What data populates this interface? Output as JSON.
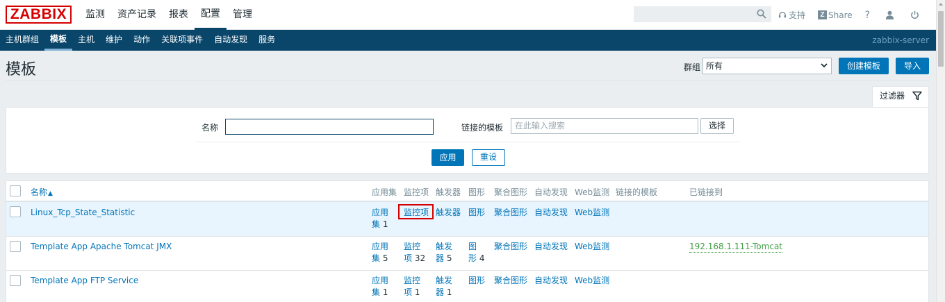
{
  "logo": "ZABBIX",
  "main_menu": [
    "监测",
    "资产记录",
    "报表",
    "配置",
    "管理"
  ],
  "main_menu_active": "配置",
  "search": {
    "placeholder": "",
    "value": ""
  },
  "tools": {
    "support": "支持",
    "share": "Share",
    "help": "?"
  },
  "sub_menu": [
    "主机群组",
    "模板",
    "主机",
    "维护",
    "动作",
    "关联项事件",
    "自动发现",
    "服务"
  ],
  "sub_menu_active": "模板",
  "server_name": "zabbix-server",
  "page_title": "模板",
  "header": {
    "group_label": "群组",
    "group_value": "所有",
    "create_button": "创建模板",
    "import_button": "导入"
  },
  "filter": {
    "tab_label": "过滤器",
    "name_label": "名称",
    "name_value": "",
    "linked_label": "链接的模板",
    "linked_placeholder": "在此输入搜索",
    "select_button": "选择",
    "apply_button": "应用",
    "reset_button": "重设"
  },
  "table": {
    "columns": {
      "name": "名称",
      "sort_indicator": "▲",
      "applications": "应用集",
      "items": "监控项",
      "triggers": "触发器",
      "graphs": "图形",
      "screens": "聚合图形",
      "discovery": "自动发现",
      "web": "Web监测",
      "linked_templates": "链接的模板",
      "linked_to": "已链接到"
    },
    "rows": [
      {
        "name": "Linux_Tcp_State_Statistic",
        "applications": {
          "line1": "应用",
          "line2": "集",
          "count": "1"
        },
        "items": "监控项",
        "triggers": "触发器",
        "graphs": "图形",
        "screens": "聚合图形",
        "discovery": "自动发现",
        "web": "Web监测",
        "linked_to": ""
      },
      {
        "name": "Template App Apache Tomcat JMX",
        "applications": {
          "line1": "应用",
          "line2": "集",
          "count": "5"
        },
        "items": {
          "line1": "监控",
          "line2": "项",
          "count": "32"
        },
        "triggers": {
          "line1": "触发",
          "line2": "器",
          "count": "5"
        },
        "graphs": {
          "line1": "图",
          "line2": "形",
          "count": "4"
        },
        "screens": "聚合图形",
        "discovery": "自动发现",
        "web": "Web监测",
        "linked_to": "192.168.1.111-Tomcat"
      },
      {
        "name": "Template App FTP Service",
        "applications": {
          "line1": "应用",
          "line2": "集",
          "count": "1"
        },
        "items": {
          "line1": "监控",
          "line2": "项",
          "count": "1"
        },
        "triggers": {
          "line1": "触发",
          "line2": "器",
          "count": "1"
        },
        "graphs": "图形",
        "screens": "聚合图形",
        "discovery": "自动发现",
        "web": "Web监测",
        "linked_to": ""
      }
    ]
  }
}
